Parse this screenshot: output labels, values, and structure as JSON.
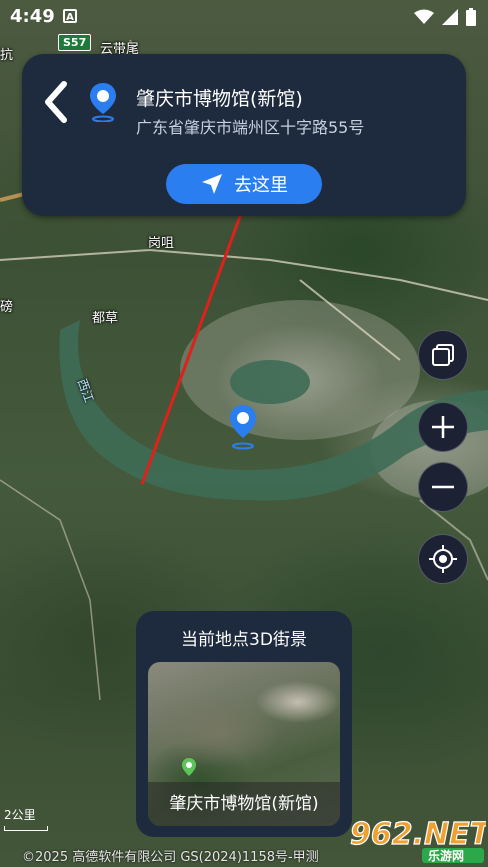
{
  "status_bar": {
    "time": "4:49",
    "notification_icon_letter": "A",
    "icons": [
      "wifi-icon",
      "cell-signal-icon",
      "battery-icon"
    ]
  },
  "map": {
    "labels": {
      "top_left_partial": "抗",
      "road_shield": "S57",
      "village_1": "云带尾",
      "village_2": "岗咀",
      "village_3": "都草",
      "left_partial": "磅",
      "river": "西江"
    },
    "scale": "2公里",
    "copyright": "©2025 高德软件有限公司 GS(2024)1158号-甲测",
    "colors": {
      "river": "#3e6b55",
      "road": "#d7a25a"
    }
  },
  "place_card": {
    "name": "肇庆市博物馆(新馆)",
    "address": "广东省肇庆市端州区十字路55号",
    "go_label": "去这里",
    "accent_color": "#2b7ef0"
  },
  "controls": [
    "layers-icon",
    "zoom-in-icon",
    "zoom-out-icon",
    "locate-icon"
  ],
  "street_view": {
    "title": "当前地点3D街景",
    "thumb_label": "肇庆市博物馆(新馆)"
  },
  "watermark": {
    "main": "962.NET",
    "sub": "乐游网"
  }
}
